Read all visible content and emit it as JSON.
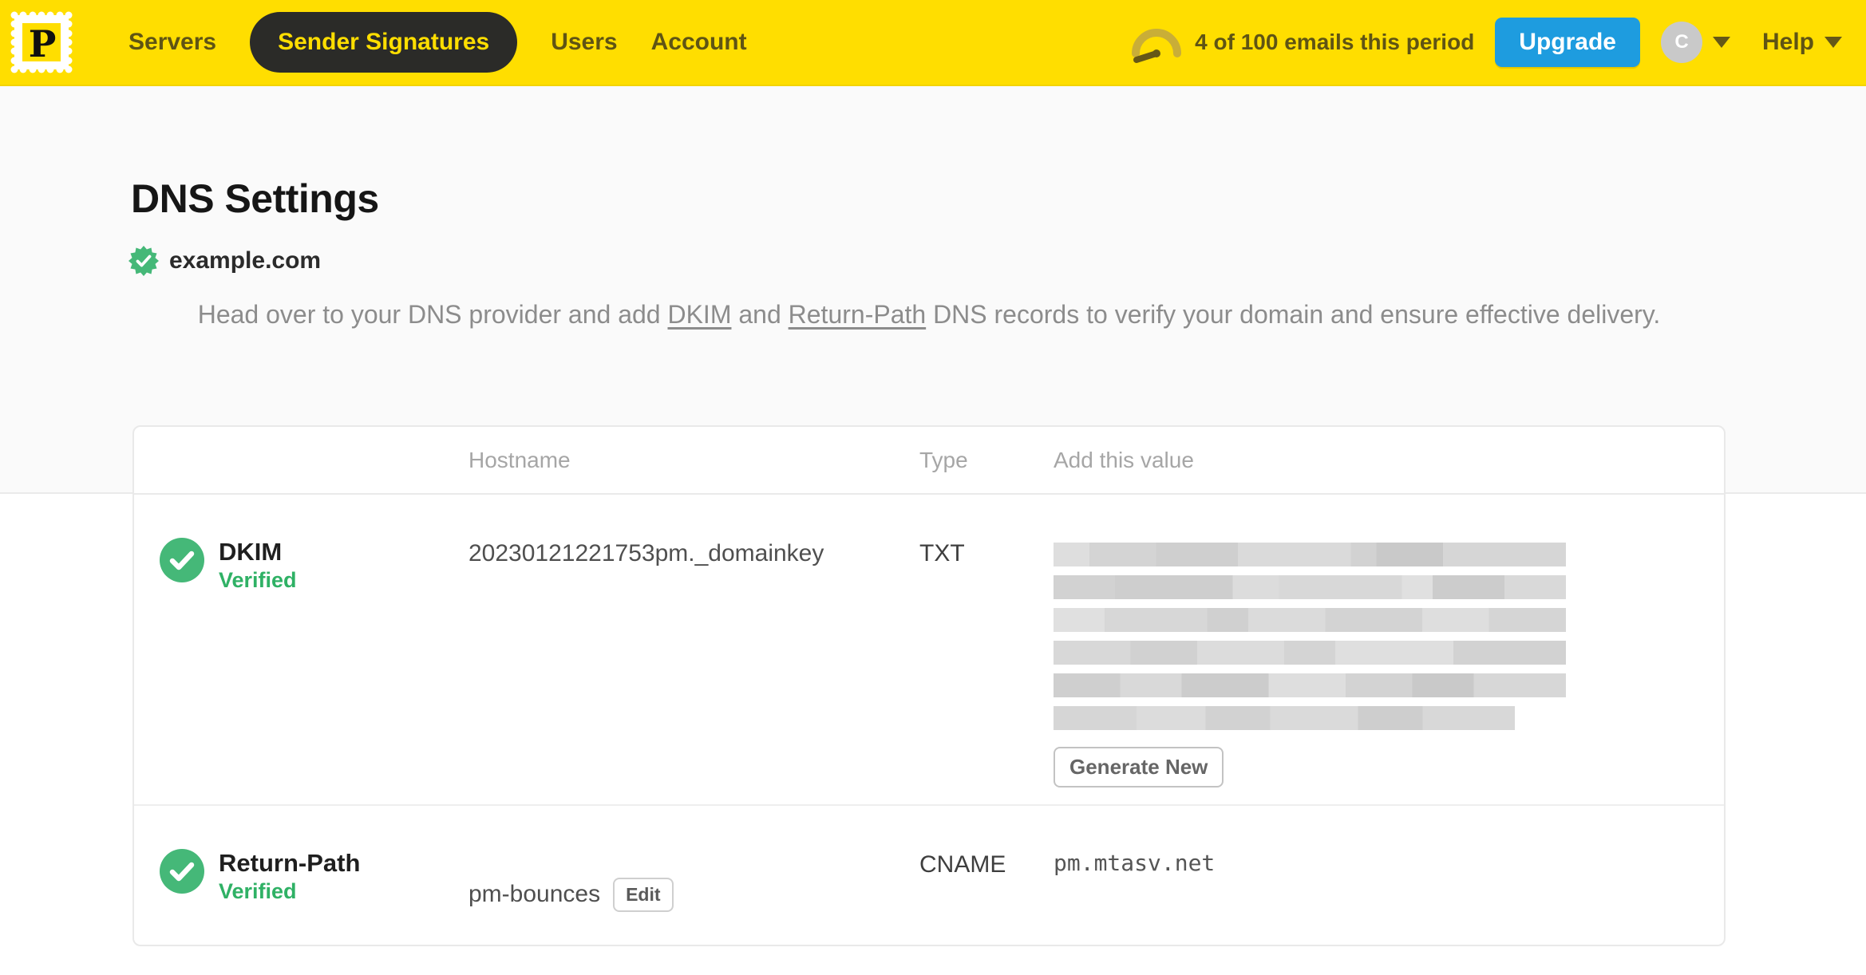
{
  "navbar": {
    "logo_letter": "P",
    "items": [
      {
        "label": "Servers",
        "active": false
      },
      {
        "label": "Sender Signatures",
        "active": true
      },
      {
        "label": "Users",
        "active": false
      },
      {
        "label": "Account",
        "active": false
      }
    ],
    "usage_text": "4 of 100 emails this period",
    "upgrade_label": "Upgrade",
    "avatar_initial": "C",
    "help_label": "Help"
  },
  "page": {
    "title": "DNS Settings",
    "domain": "example.com",
    "description": {
      "part1": "Head over to your DNS provider and add ",
      "link1": "DKIM",
      "part2": " and ",
      "link2": "Return-Path",
      "part3": " DNS records to verify your domain and ensure effective delivery."
    }
  },
  "table": {
    "headers": {
      "hostname": "Hostname",
      "type": "Type",
      "value": "Add this value"
    },
    "rows": [
      {
        "name": "DKIM",
        "status": "Verified",
        "hostname": "20230121221753pm._domainkey",
        "type": "TXT",
        "value_redacted_lines": 6,
        "action_label": "Generate New"
      },
      {
        "name": "Return-Path",
        "status": "Verified",
        "hostname": "pm-bounces",
        "edit_label": "Edit",
        "type": "CNAME",
        "value": "pm.mtasv.net"
      }
    ]
  },
  "colors": {
    "brand_yellow": "#FFDE00",
    "nav_text_olive": "#5f5414",
    "active_pill_bg": "#2b2b28",
    "upgrade_blue": "#1e9cdf",
    "verified_green": "#45b878",
    "verified_text_green": "#2fb165",
    "description_gray": "#8c8c8c"
  }
}
